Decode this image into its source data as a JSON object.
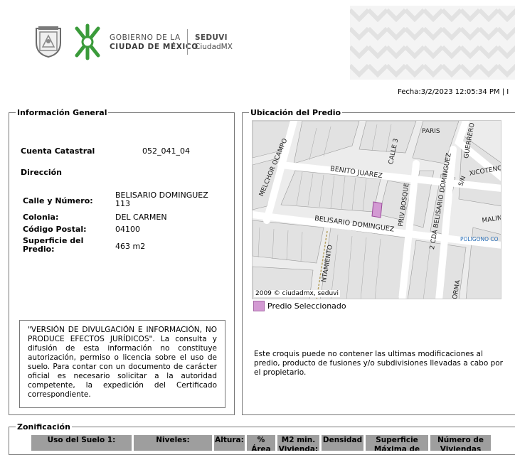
{
  "header": {
    "gov_line1": "GOBIERNO DE LA",
    "gov_line2": "CIUDAD DE MÉXICO",
    "seduvi_line1": "SEDUVI",
    "seduvi_line2": "CiudadMX"
  },
  "fecha": "Fecha:3/2/2023 12:05:34 PM | I",
  "info_general": {
    "legend": "Información General",
    "cuenta_label": "Cuenta Catastral",
    "cuenta_value": "052_041_04",
    "direccion_label": "Dirección",
    "calle_label": "Calle y Número:",
    "calle_value_1": "BELISARIO DOMINGUEZ",
    "calle_value_2": "113",
    "colonia_label": "Colonia:",
    "colonia_value": "DEL CARMEN",
    "cp_label": "Código Postal:",
    "cp_value": "04100",
    "superficie_label_1": "Superficie del",
    "superficie_label_2": "Predio:",
    "superficie_value": "463 m2"
  },
  "disclaimer": "\"VERSIÓN DE DIVULGACIÓN E INFORMACIÓN, NO PRODUCE EFECTOS JURÍDICOS\". La consulta y difusión de esta información no constituye autorización, permiso o licencia sobre el uso de suelo. Para contar con un documento de carácter oficial es necesario solicitar a la autoridad competente, la expedición del Certificado correspondiente.",
  "ubicacion": {
    "legend": "Ubicación del Predio",
    "map_credit": "2009 © ciudadmx, seduvi",
    "legend_label": "Predio Seleccionado",
    "croquis_note": "Este croquis puede no contener las ultimas modificaciones al predio, producto de fusiones y/o subdivisiones llevadas a cabo por el propietario.",
    "streets": {
      "melchor": "MELCHOR OCAMPO",
      "calle3": "CALLE 3",
      "paris": "PARIS",
      "guerrero": "GUERRERO",
      "benito": "BENITO JUAREZ",
      "priv": "PRIV BOSQUE",
      "cda": "2 CDA BELISARIO DOMINGUEZ",
      "sn": "S/N",
      "xicotencatl": "XICOTENC",
      "malin": "MALIN",
      "belisario": "BELISARIO DOMINGUEZ",
      "ayunt": "NTAMIENTO",
      "poligono": "POLIGONO CO",
      "orma": "ORMA"
    }
  },
  "zonificacion": {
    "legend": "Zonificación",
    "columns": [
      {
        "l1": "Uso del Suelo 1:",
        "l2": ""
      },
      {
        "l1": "Niveles:",
        "l2": ""
      },
      {
        "l1": "Altura:",
        "l2": ""
      },
      {
        "l1": "%",
        "l2": "Área"
      },
      {
        "l1": "M2 min.",
        "l2": "Vivienda:"
      },
      {
        "l1": "Densidad",
        "l2": ""
      },
      {
        "l1": "Superficie",
        "l2": "Máxima de"
      },
      {
        "l1": "Número de",
        "l2": "Viviendas"
      }
    ]
  },
  "colors": {
    "selected_parcel": "#d39ad3",
    "logo_green": "#3a9b3a",
    "table_header": "#9e9e9e"
  }
}
